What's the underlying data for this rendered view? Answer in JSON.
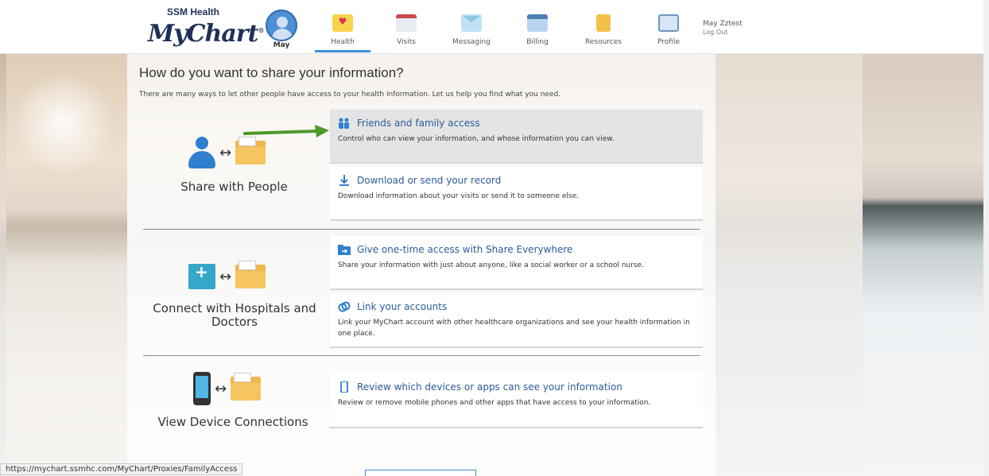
{
  "brand": {
    "top": "SSM Health",
    "main": "MyChart"
  },
  "nav": {
    "user_tab": "May",
    "tabs": [
      {
        "label": "Health",
        "icon": "heart-icon"
      },
      {
        "label": "Visits",
        "icon": "calendar-icon"
      },
      {
        "label": "Messaging",
        "icon": "envelope-icon"
      },
      {
        "label": "Billing",
        "icon": "credit-card-icon"
      },
      {
        "label": "Resources",
        "icon": "book-icon"
      },
      {
        "label": "Profile",
        "icon": "id-card-icon"
      }
    ],
    "active_tab": "Health"
  },
  "user": {
    "name": "May Zztest",
    "logout": "Log Out"
  },
  "page": {
    "title": "How do you want to share your information?",
    "subtitle": "There are many ways to let other people have access to your health information. Let us help you find what you need."
  },
  "sections": [
    {
      "label": "Share with People",
      "options": [
        {
          "title": "Friends and family access",
          "desc": "Control who can view your information, and whose information you can view.",
          "icon": "family-icon",
          "highlighted": true
        },
        {
          "title": "Download or send your record",
          "desc": "Download information about your visits or send it to someone else.",
          "icon": "download-icon"
        }
      ]
    },
    {
      "label": "Connect with Hospitals and Doctors",
      "options": [
        {
          "title": "Give one-time access with Share Everywhere",
          "desc": "Share your information with just about anyone, like a social worker or a school nurse.",
          "icon": "share-everywhere-icon"
        },
        {
          "title": "Link your accounts",
          "desc": "Link your MyChart account with other healthcare organizations and see your health information in one place.",
          "icon": "link-icon"
        }
      ]
    },
    {
      "label": "View Device Connections",
      "options": [
        {
          "title": "Review which devices or apps can see your information",
          "desc": "Review or remove mobile phones and other apps that have access to your information.",
          "icon": "mobile-device-icon"
        }
      ]
    }
  ],
  "status_bar": {
    "url": "https://mychart.ssmhc.com/MyChart/Proxies/FamilyAccess"
  },
  "colors": {
    "link": "#2a5d9a",
    "accent": "#3b8ed6",
    "arrow": "#4c9a2a"
  }
}
